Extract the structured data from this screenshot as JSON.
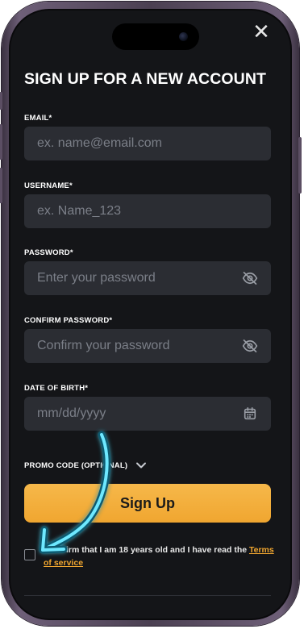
{
  "modal": {
    "close_glyph": "✕",
    "title": "SIGN UP FOR A NEW ACCOUNT"
  },
  "fields": {
    "email": {
      "label": "EMAIL*",
      "placeholder": "ex. name@email.com",
      "value": ""
    },
    "username": {
      "label": "USERNAME*",
      "placeholder": "ex. Name_123",
      "value": ""
    },
    "password": {
      "label": "PASSWORD*",
      "placeholder": "Enter your password",
      "value": "",
      "icon": "eye-off-icon"
    },
    "confirm_password": {
      "label": "CONFIRM PASSWORD*",
      "placeholder": "Confirm your password",
      "value": "",
      "icon": "eye-off-icon"
    },
    "date_of_birth": {
      "label": "DATE OF BIRTH*",
      "placeholder": "mm/dd/yyyy",
      "value": "",
      "icon": "calendar-icon"
    }
  },
  "promo": {
    "label": "PROMO CODE (OPTIONAL)",
    "icon": "chevron-down-icon"
  },
  "signup_button": {
    "label": "Sign Up"
  },
  "terms": {
    "checked": false,
    "text": "I confirm that I am 18 years old and I have read the ",
    "link": "Terms of service"
  },
  "colors": {
    "background": "#141518",
    "field": "#2b2d33",
    "accent": "#f0a630",
    "annotation_arrow": "#5fe3ff"
  }
}
